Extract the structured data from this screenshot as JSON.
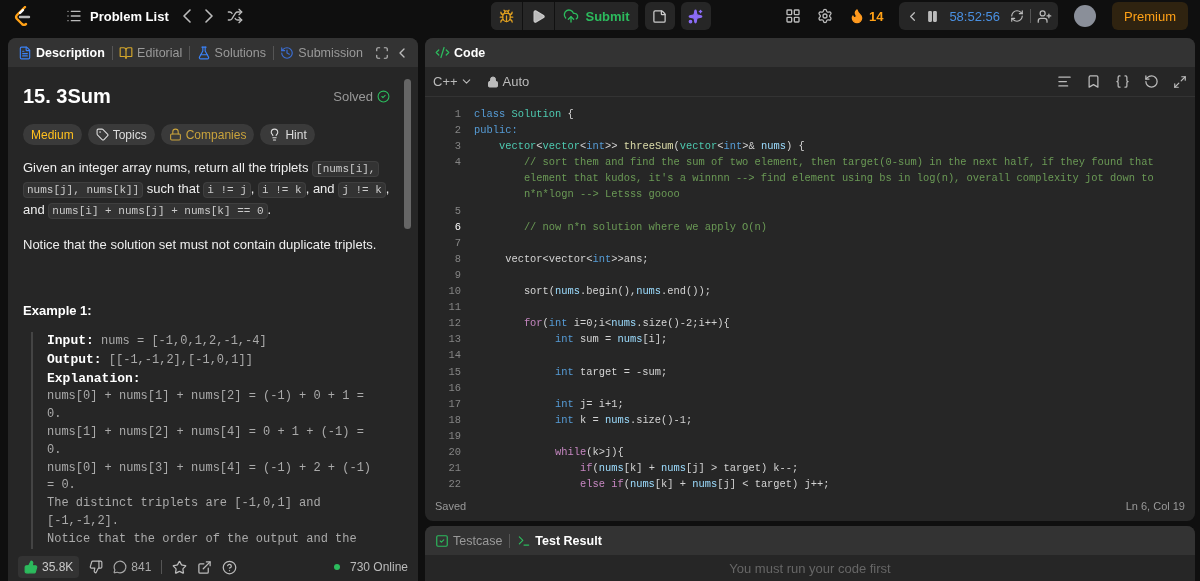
{
  "topbar": {
    "problem_list": "Problem List",
    "submit": "Submit",
    "streak": "14",
    "timer": "58:52:56",
    "premium": "Premium"
  },
  "description_panel": {
    "tabs": [
      {
        "label": "Description",
        "selected": true
      },
      {
        "label": "Editorial",
        "selected": false
      },
      {
        "label": "Solutions",
        "selected": false
      },
      {
        "label": "Submission",
        "selected": false
      }
    ],
    "title": "15. 3Sum",
    "status": "Solved",
    "tags": [
      {
        "label": "Medium",
        "kind": "difficulty"
      },
      {
        "label": "Topics",
        "kind": "topics"
      },
      {
        "label": "Companies",
        "kind": "companies"
      },
      {
        "label": "Hint",
        "kind": "hint"
      }
    ],
    "statement": [
      {
        "kind": "text",
        "text": "Given an integer array nums, return all the triplets "
      },
      {
        "kind": "code",
        "text": "[nums[i], nums[j], nums[k]]"
      },
      {
        "kind": "text",
        "text": " such that "
      },
      {
        "kind": "code",
        "text": "i != j"
      },
      {
        "kind": "text",
        "text": ", "
      },
      {
        "kind": "code",
        "text": "i != k"
      },
      {
        "kind": "text",
        "text": ", and "
      },
      {
        "kind": "code",
        "text": "j != k"
      },
      {
        "kind": "text",
        "text": ", and "
      },
      {
        "kind": "code",
        "text": "nums[i] + nums[j] + nums[k] == 0"
      },
      {
        "kind": "text",
        "text": "."
      }
    ],
    "note": "Notice that the solution set must not contain duplicate triplets.",
    "example": {
      "heading": "Example 1:",
      "rows": [
        {
          "label": "Input:",
          "value": "nums = [-1,0,1,2,-1,-4]"
        },
        {
          "label": "Output:",
          "value": "[[-1,-1,2],[-1,0,1]]"
        },
        {
          "label": "Explanation:",
          "value": ""
        }
      ],
      "explanation": "nums[0] + nums[1] + nums[2] = (-1) + 0 + 1 = 0.\nnums[1] + nums[2] + nums[4] = 0 + 1 + (-1) = 0.\nnums[0] + nums[3] + nums[4] = (-1) + 2 + (-1) = 0.\nThe distinct triplets are [-1,0,1] and [-1,-1,2].\nNotice that the order of the output and the"
    },
    "footer": {
      "likes": "35.8K",
      "comments": "841",
      "online": "730 Online"
    }
  },
  "editor": {
    "title": "Code",
    "language": "C++",
    "mode": "Auto",
    "status": "Saved",
    "cursor": "Ln 6, Col 19",
    "lines": [
      {
        "number": "1",
        "current": false,
        "tokens": [
          {
            "text": "class ",
            "kind": "kw"
          },
          {
            "text": "Solution",
            "kind": "type"
          },
          {
            "text": " {",
            "kind": "plain"
          }
        ]
      },
      {
        "number": "2",
        "current": false,
        "tokens": [
          {
            "text": "public:",
            "kind": "kw"
          }
        ]
      },
      {
        "number": "3",
        "current": false,
        "tokens": [
          {
            "text": "    vector",
            "kind": "type"
          },
          {
            "text": "<",
            "kind": "plain"
          },
          {
            "text": "vector",
            "kind": "type"
          },
          {
            "text": "<",
            "kind": "plain"
          },
          {
            "text": "int",
            "kind": "kw"
          },
          {
            "text": ">> ",
            "kind": "plain"
          },
          {
            "text": "threeSum",
            "kind": "fn"
          },
          {
            "text": "(",
            "kind": "plain"
          },
          {
            "text": "vector",
            "kind": "type"
          },
          {
            "text": "<",
            "kind": "plain"
          },
          {
            "text": "int",
            "kind": "kw"
          },
          {
            "text": ">& ",
            "kind": "plain"
          },
          {
            "text": "nums",
            "kind": "var"
          },
          {
            "text": ") {",
            "kind": "plain"
          }
        ]
      },
      {
        "number": "4",
        "current": false,
        "tokens": [
          {
            "text": "        // sort them and find the sum of two element, then target(0-sum) in the next half, if they found that element that kudos, it's a winnnn --> find element using bs in log(n), overall complexity jot down to n*n*logn --> Letsss goooo",
            "kind": "comment"
          }
        ]
      },
      {
        "number": "5",
        "current": false
      },
      {
        "number": "6",
        "current": true,
        "tokens": [
          {
            "text": "        // now n*n solution where we apply O(n)",
            "kind": "comment"
          }
        ]
      },
      {
        "number": "7",
        "current": false
      },
      {
        "number": "8",
        "current": false,
        "tokens": [
          {
            "text": "     vector<vector<",
            "kind": "plain"
          },
          {
            "text": "int",
            "kind": "kw"
          },
          {
            "text": ">>ans;",
            "kind": "plain"
          }
        ]
      },
      {
        "number": "9",
        "current": false
      },
      {
        "number": "10",
        "current": false,
        "tokens": [
          {
            "text": "        sort(",
            "kind": "plain"
          },
          {
            "text": "nums",
            "kind": "var"
          },
          {
            "text": ".begin(),",
            "kind": "plain"
          },
          {
            "text": "nums",
            "kind": "var"
          },
          {
            "text": ".end());",
            "kind": "plain"
          }
        ]
      },
      {
        "number": "11",
        "current": false
      },
      {
        "number": "12",
        "current": false,
        "tokens": [
          {
            "text": "        for",
            "kind": "ctrl"
          },
          {
            "text": "(",
            "kind": "plain"
          },
          {
            "text": "int",
            "kind": "kw"
          },
          {
            "text": " i=0;i<",
            "kind": "plain"
          },
          {
            "text": "nums",
            "kind": "var"
          },
          {
            "text": ".size()-2;i++){",
            "kind": "plain"
          }
        ]
      },
      {
        "number": "13",
        "current": false,
        "tokens": [
          {
            "text": "             int",
            "kind": "kw"
          },
          {
            "text": " sum = ",
            "kind": "plain"
          },
          {
            "text": "nums",
            "kind": "var"
          },
          {
            "text": "[i];",
            "kind": "plain"
          }
        ]
      },
      {
        "number": "14",
        "current": false
      },
      {
        "number": "15",
        "current": false,
        "tokens": [
          {
            "text": "             int",
            "kind": "kw"
          },
          {
            "text": " target = -sum;",
            "kind": "plain"
          }
        ]
      },
      {
        "number": "16",
        "current": false
      },
      {
        "number": "17",
        "current": false,
        "tokens": [
          {
            "text": "             int",
            "kind": "kw"
          },
          {
            "text": " j= i+1;",
            "kind": "plain"
          }
        ]
      },
      {
        "number": "18",
        "current": false,
        "tokens": [
          {
            "text": "             int",
            "kind": "kw"
          },
          {
            "text": " k = ",
            "kind": "plain"
          },
          {
            "text": "nums",
            "kind": "var"
          },
          {
            "text": ".size()-1;",
            "kind": "plain"
          }
        ]
      },
      {
        "number": "19",
        "current": false
      },
      {
        "number": "20",
        "current": false,
        "tokens": [
          {
            "text": "             while",
            "kind": "ctrl"
          },
          {
            "text": "(k>j){",
            "kind": "plain"
          }
        ]
      },
      {
        "number": "21",
        "current": false,
        "tokens": [
          {
            "text": "                 if",
            "kind": "ctrl"
          },
          {
            "text": "(",
            "kind": "plain"
          },
          {
            "text": "nums",
            "kind": "var"
          },
          {
            "text": "[k] + ",
            "kind": "plain"
          },
          {
            "text": "nums",
            "kind": "var"
          },
          {
            "text": "[j] > target) k--;",
            "kind": "plain"
          }
        ]
      },
      {
        "number": "22",
        "current": false,
        "tokens": [
          {
            "text": "                 else if",
            "kind": "ctrl"
          },
          {
            "text": "(",
            "kind": "plain"
          },
          {
            "text": "nums",
            "kind": "var"
          },
          {
            "text": "[k] + ",
            "kind": "plain"
          },
          {
            "text": "nums",
            "kind": "var"
          },
          {
            "text": "[j] < target) j++;",
            "kind": "plain"
          }
        ]
      }
    ]
  },
  "results": {
    "tabs": [
      {
        "label": "Testcase",
        "selected": false
      },
      {
        "label": "Test Result",
        "selected": true
      }
    ],
    "message": "You must run your code first"
  }
}
